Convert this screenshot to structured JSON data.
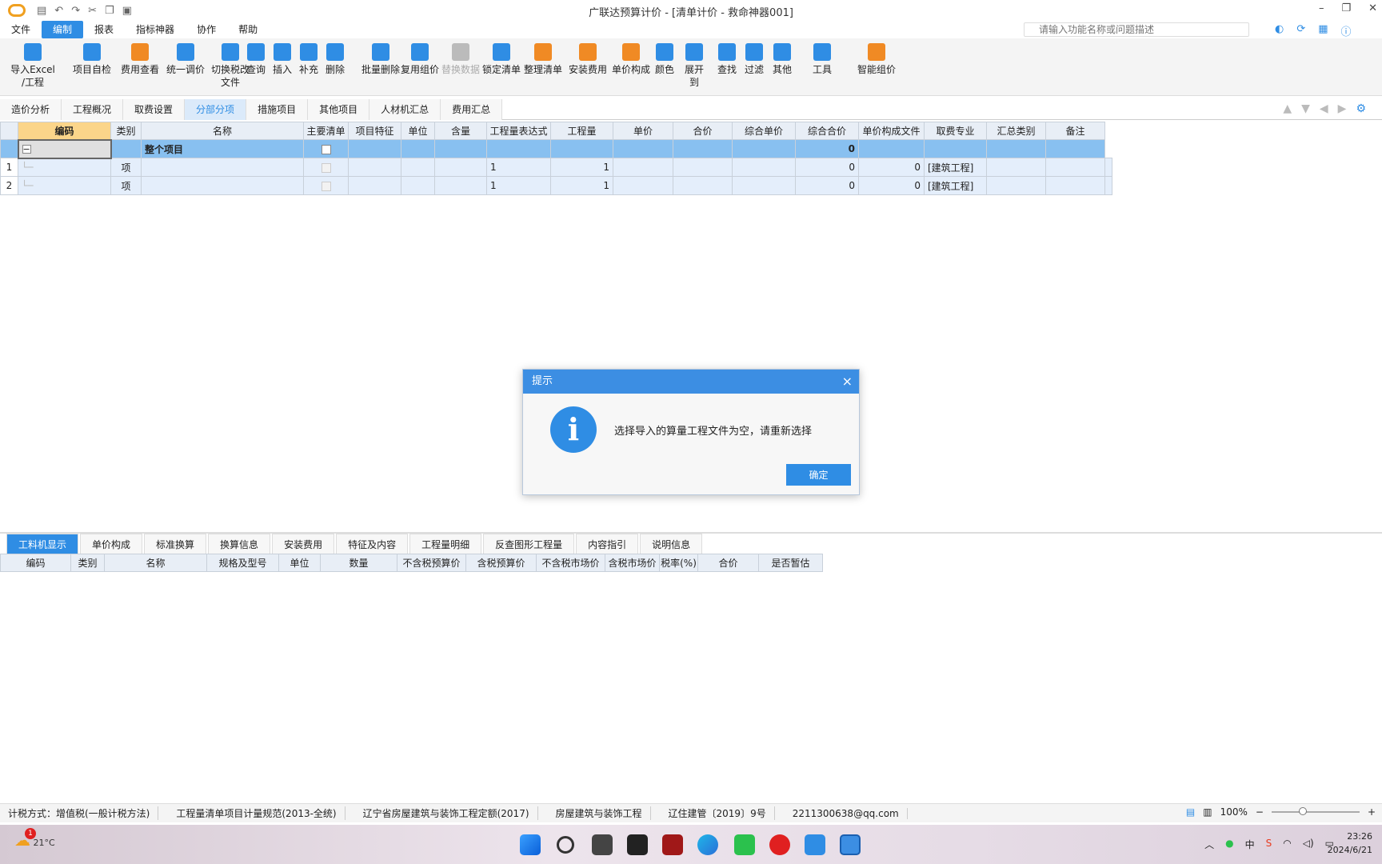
{
  "window": {
    "title": "广联达预算计价 - [清单计价 - 救命神器001]"
  },
  "menu": [
    "文件",
    "编制",
    "报表",
    "指标神器",
    "协作",
    "帮助"
  ],
  "search": {
    "placeholder": "请输入功能名称或问题描述"
  },
  "ribbon": [
    {
      "label": "导入Excel\n/工程",
      "icon": "import-excel-icon",
      "color": "#2f8de4"
    },
    {
      "label": "项目自检",
      "icon": "project-check-icon",
      "color": "#2f8de4"
    },
    {
      "label": "费用查看",
      "icon": "fee-view-icon",
      "color": "#f08a24"
    },
    {
      "label": "统一调价",
      "icon": "adjust-price-icon",
      "color": "#2f8de4"
    },
    {
      "label": "切换税改\n文件",
      "icon": "switch-tax-icon",
      "color": "#2f8de4"
    },
    {
      "label": "查询",
      "icon": "query-icon",
      "color": "#2f8de4"
    },
    {
      "label": "插入",
      "icon": "insert-icon",
      "color": "#2f8de4"
    },
    {
      "label": "补充",
      "icon": "supplement-icon",
      "color": "#2f8de4"
    },
    {
      "label": "删除",
      "icon": "delete-icon",
      "color": "#2f8de4"
    },
    {
      "label": "批量删除",
      "icon": "batch-delete-icon",
      "color": "#2f8de4"
    },
    {
      "label": "复用组价",
      "icon": "reuse-price-icon",
      "color": "#2f8de4"
    },
    {
      "label": "替换数据",
      "icon": "replace-data-icon",
      "color": "#bbbbbb"
    },
    {
      "label": "锁定清单",
      "icon": "lock-list-icon",
      "color": "#2f8de4"
    },
    {
      "label": "整理清单",
      "icon": "organize-list-icon",
      "color": "#f08a24"
    },
    {
      "label": "安装费用",
      "icon": "install-fee-icon",
      "color": "#f08a24"
    },
    {
      "label": "单价构成",
      "icon": "unit-price-icon",
      "color": "#f08a24"
    },
    {
      "label": "颜色",
      "icon": "color-icon",
      "color": "#2f8de4"
    },
    {
      "label": "展开到",
      "icon": "expand-icon",
      "color": "#2f8de4"
    },
    {
      "label": "查找",
      "icon": "find-icon",
      "color": "#2f8de4"
    },
    {
      "label": "过滤",
      "icon": "filter-icon",
      "color": "#2f8de4"
    },
    {
      "label": "其他",
      "icon": "other-icon",
      "color": "#2f8de4"
    },
    {
      "label": "工具",
      "icon": "tools-icon",
      "color": "#2f8de4"
    },
    {
      "label": "智能组价",
      "icon": "smart-price-icon",
      "color": "#f08a24"
    }
  ],
  "tabs": [
    "造价分析",
    "工程概况",
    "取费设置",
    "分部分项",
    "措施项目",
    "其他项目",
    "人材机汇总",
    "费用汇总"
  ],
  "active_tab": "分部分项",
  "grid": {
    "headers": [
      "编码",
      "类别",
      "名称",
      "主要清单",
      "项目特征",
      "单位",
      "含量",
      "工程量表达式",
      "工程量",
      "单价",
      "合价",
      "综合单价",
      "综合合价",
      "单价构成文件",
      "取费专业",
      "汇总类别",
      "备注"
    ],
    "top_row": {
      "expander": "−",
      "name": "整个项目",
      "total": "0"
    },
    "rows": [
      {
        "index": "1",
        "type": "项",
        "expr": "1",
        "qty": "1",
        "unit_price": "0",
        "total": "0",
        "file": "[建筑工程]"
      },
      {
        "index": "2",
        "type": "项",
        "expr": "1",
        "qty": "1",
        "unit_price": "0",
        "total": "0",
        "file": "[建筑工程]"
      }
    ]
  },
  "dialog": {
    "title": "提示",
    "message": "选择导入的算量工程文件为空，请重新选择",
    "ok": "确定",
    "close": "×"
  },
  "bottom_tabs": [
    "工料机显示",
    "单价构成",
    "标准换算",
    "换算信息",
    "安装费用",
    "特征及内容",
    "工程量明细",
    "反查图形工程量",
    "内容指引",
    "说明信息"
  ],
  "bottom_headers": [
    "编码",
    "类别",
    "名称",
    "规格及型号",
    "单位",
    "数量",
    "不含税预算价",
    "含税预算价",
    "不含税市场价",
    "含税市场价",
    "税率(%)",
    "合价",
    "是否暂估"
  ],
  "status": [
    "计税方式：增值税(一般计税方法)",
    "工程量清单项目计量规范(2013-全统)",
    "辽宁省房屋建筑与装饰工程定额(2017)",
    "房屋建筑与装饰工程",
    "辽住建管〔2019〕9号",
    "2211300638@qq.com"
  ],
  "zoom": "100%",
  "taskbar": {
    "weather_temp": "21°C",
    "badge": "1",
    "ime": "中",
    "time": "23:26",
    "date": "2024/6/21"
  }
}
